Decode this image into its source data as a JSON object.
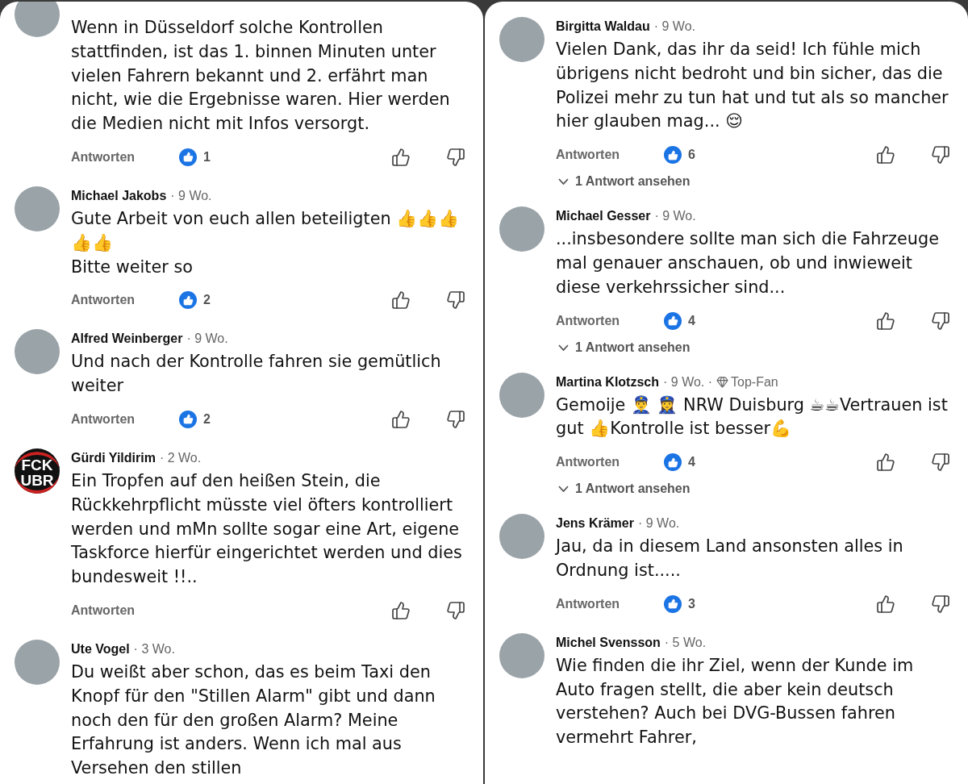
{
  "columns": [
    {
      "comments": [
        {
          "text": "Wenn in Düsseldorf solche Kontrollen stattfinden, ist das 1. binnen Minuten unter vielen Fahrern bekannt und 2. erfährt man nicht, wie die Ergebnisse waren. Hier werden die Medien nicht mit Infos versorgt.",
          "reply": "Antworten",
          "likes": "1"
        },
        {
          "name": "Michael Jakobs",
          "age": "· 9 Wo.",
          "text": "Gute Arbeit von euch allen beteiligten 👍👍👍👍👍\nBitte weiter so",
          "reply": "Antworten",
          "likes": "2"
        },
        {
          "name": "Alfred Weinberger",
          "age": "· 9 Wo.",
          "text": "Und nach der Kontrolle fahren sie gemütlich weiter",
          "reply": "Antworten",
          "likes": "2"
        },
        {
          "avatar_text": [
            "FCK",
            "UBR"
          ],
          "name": "Gürdi Yildirim",
          "age": "· 2 Wo.",
          "text": "Ein Tropfen auf den heißen Stein, die Rückkehrpflicht müsste viel öfters kontrolliert werden und mMn sollte sogar eine Art, eigene Taskforce hierfür eingerichtet werden und dies bundesweit !!..",
          "reply": "Antworten"
        },
        {
          "name": "Ute Vogel",
          "age": "· 3 Wo.",
          "text": "Du weißt aber schon, das es beim Taxi den Knopf für den \"Stillen Alarm\" gibt und dann noch den für den großen Alarm? Meine Erfahrung ist anders. Wenn ich mal aus Versehen den stillen"
        }
      ]
    },
    {
      "comments": [
        {
          "name": "Birgitta Waldau",
          "age": "· 9 Wo.",
          "text": "Vielen Dank, das ihr da seid! Ich fühle mich übrigens nicht bedroht und bin sicher, das die Polizei mehr zu tun hat und tut als so mancher hier glauben mag... 😌",
          "reply": "Antworten",
          "likes": "6",
          "replies": "1 Antwort ansehen"
        },
        {
          "name": "Michael Gesser",
          "age": "· 9 Wo.",
          "text": "...insbesondere sollte man sich die Fahrzeuge mal genauer anschauen, ob und inwieweit diese verkehrssicher sind...",
          "reply": "Antworten",
          "likes": "4",
          "replies": "1 Antwort ansehen"
        },
        {
          "name": "Martina Klotzsch",
          "age": "· 9 Wo. ·",
          "badge": "Top-Fan",
          "text": "Gemoije 👮‍♂️ 👮‍♀️ NRW Duisburg ☕☕Vertrauen ist gut 👍Kontrolle ist besser💪",
          "reply": "Antworten",
          "likes": "4",
          "replies": "1 Antwort ansehen"
        },
        {
          "name": "Jens Krämer",
          "age": "· 9 Wo.",
          "text": "Jau, da in diesem Land ansonsten alles in Ordnung ist.....",
          "reply": "Antworten",
          "likes": "3"
        },
        {
          "name": "Michel Svensson",
          "age": "· 5 Wo.",
          "text": "Wie finden die ihr Ziel, wenn der Kunde im Auto fragen stellt, die aber kein deutsch verstehen? Auch bei DVG-Bussen fahren vermehrt Fahrer,"
        }
      ]
    }
  ]
}
